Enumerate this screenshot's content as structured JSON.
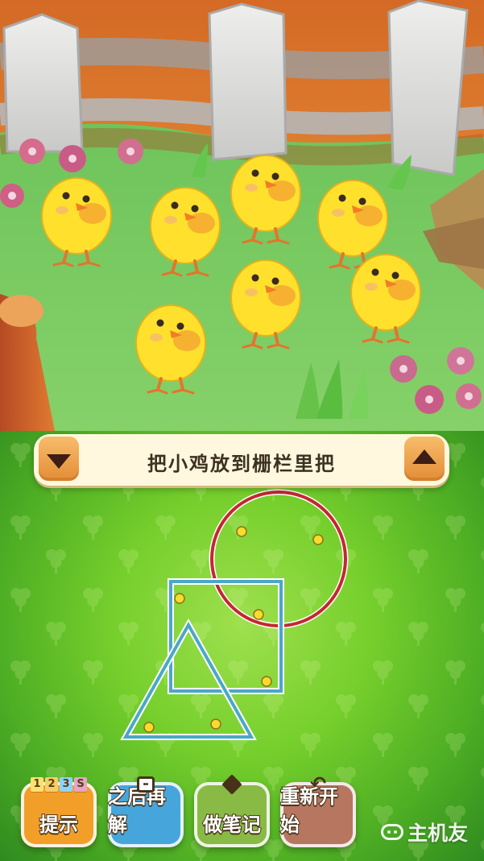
{
  "top_scene": {
    "description_hidden": "",
    "fence_color": "#d9dadb",
    "grass_color": "#78c95f"
  },
  "puzzle": {
    "instruction": "把小鸡放到栅栏里把"
  },
  "buttons": {
    "hint": {
      "label": "提示",
      "digits": [
        "1",
        "2",
        "3",
        "S"
      ]
    },
    "later": {
      "label": "之后再解"
    },
    "notes": {
      "label": "做笔记"
    },
    "restart": {
      "label": "重新开始"
    }
  },
  "watermark": {
    "text": "主机友"
  },
  "colors": {
    "circle": "#c3282f",
    "square": "#4aa8c6",
    "triangle": "#4aa8c6",
    "point": "#f7dc2b",
    "point_stroke": "#8f7020"
  }
}
